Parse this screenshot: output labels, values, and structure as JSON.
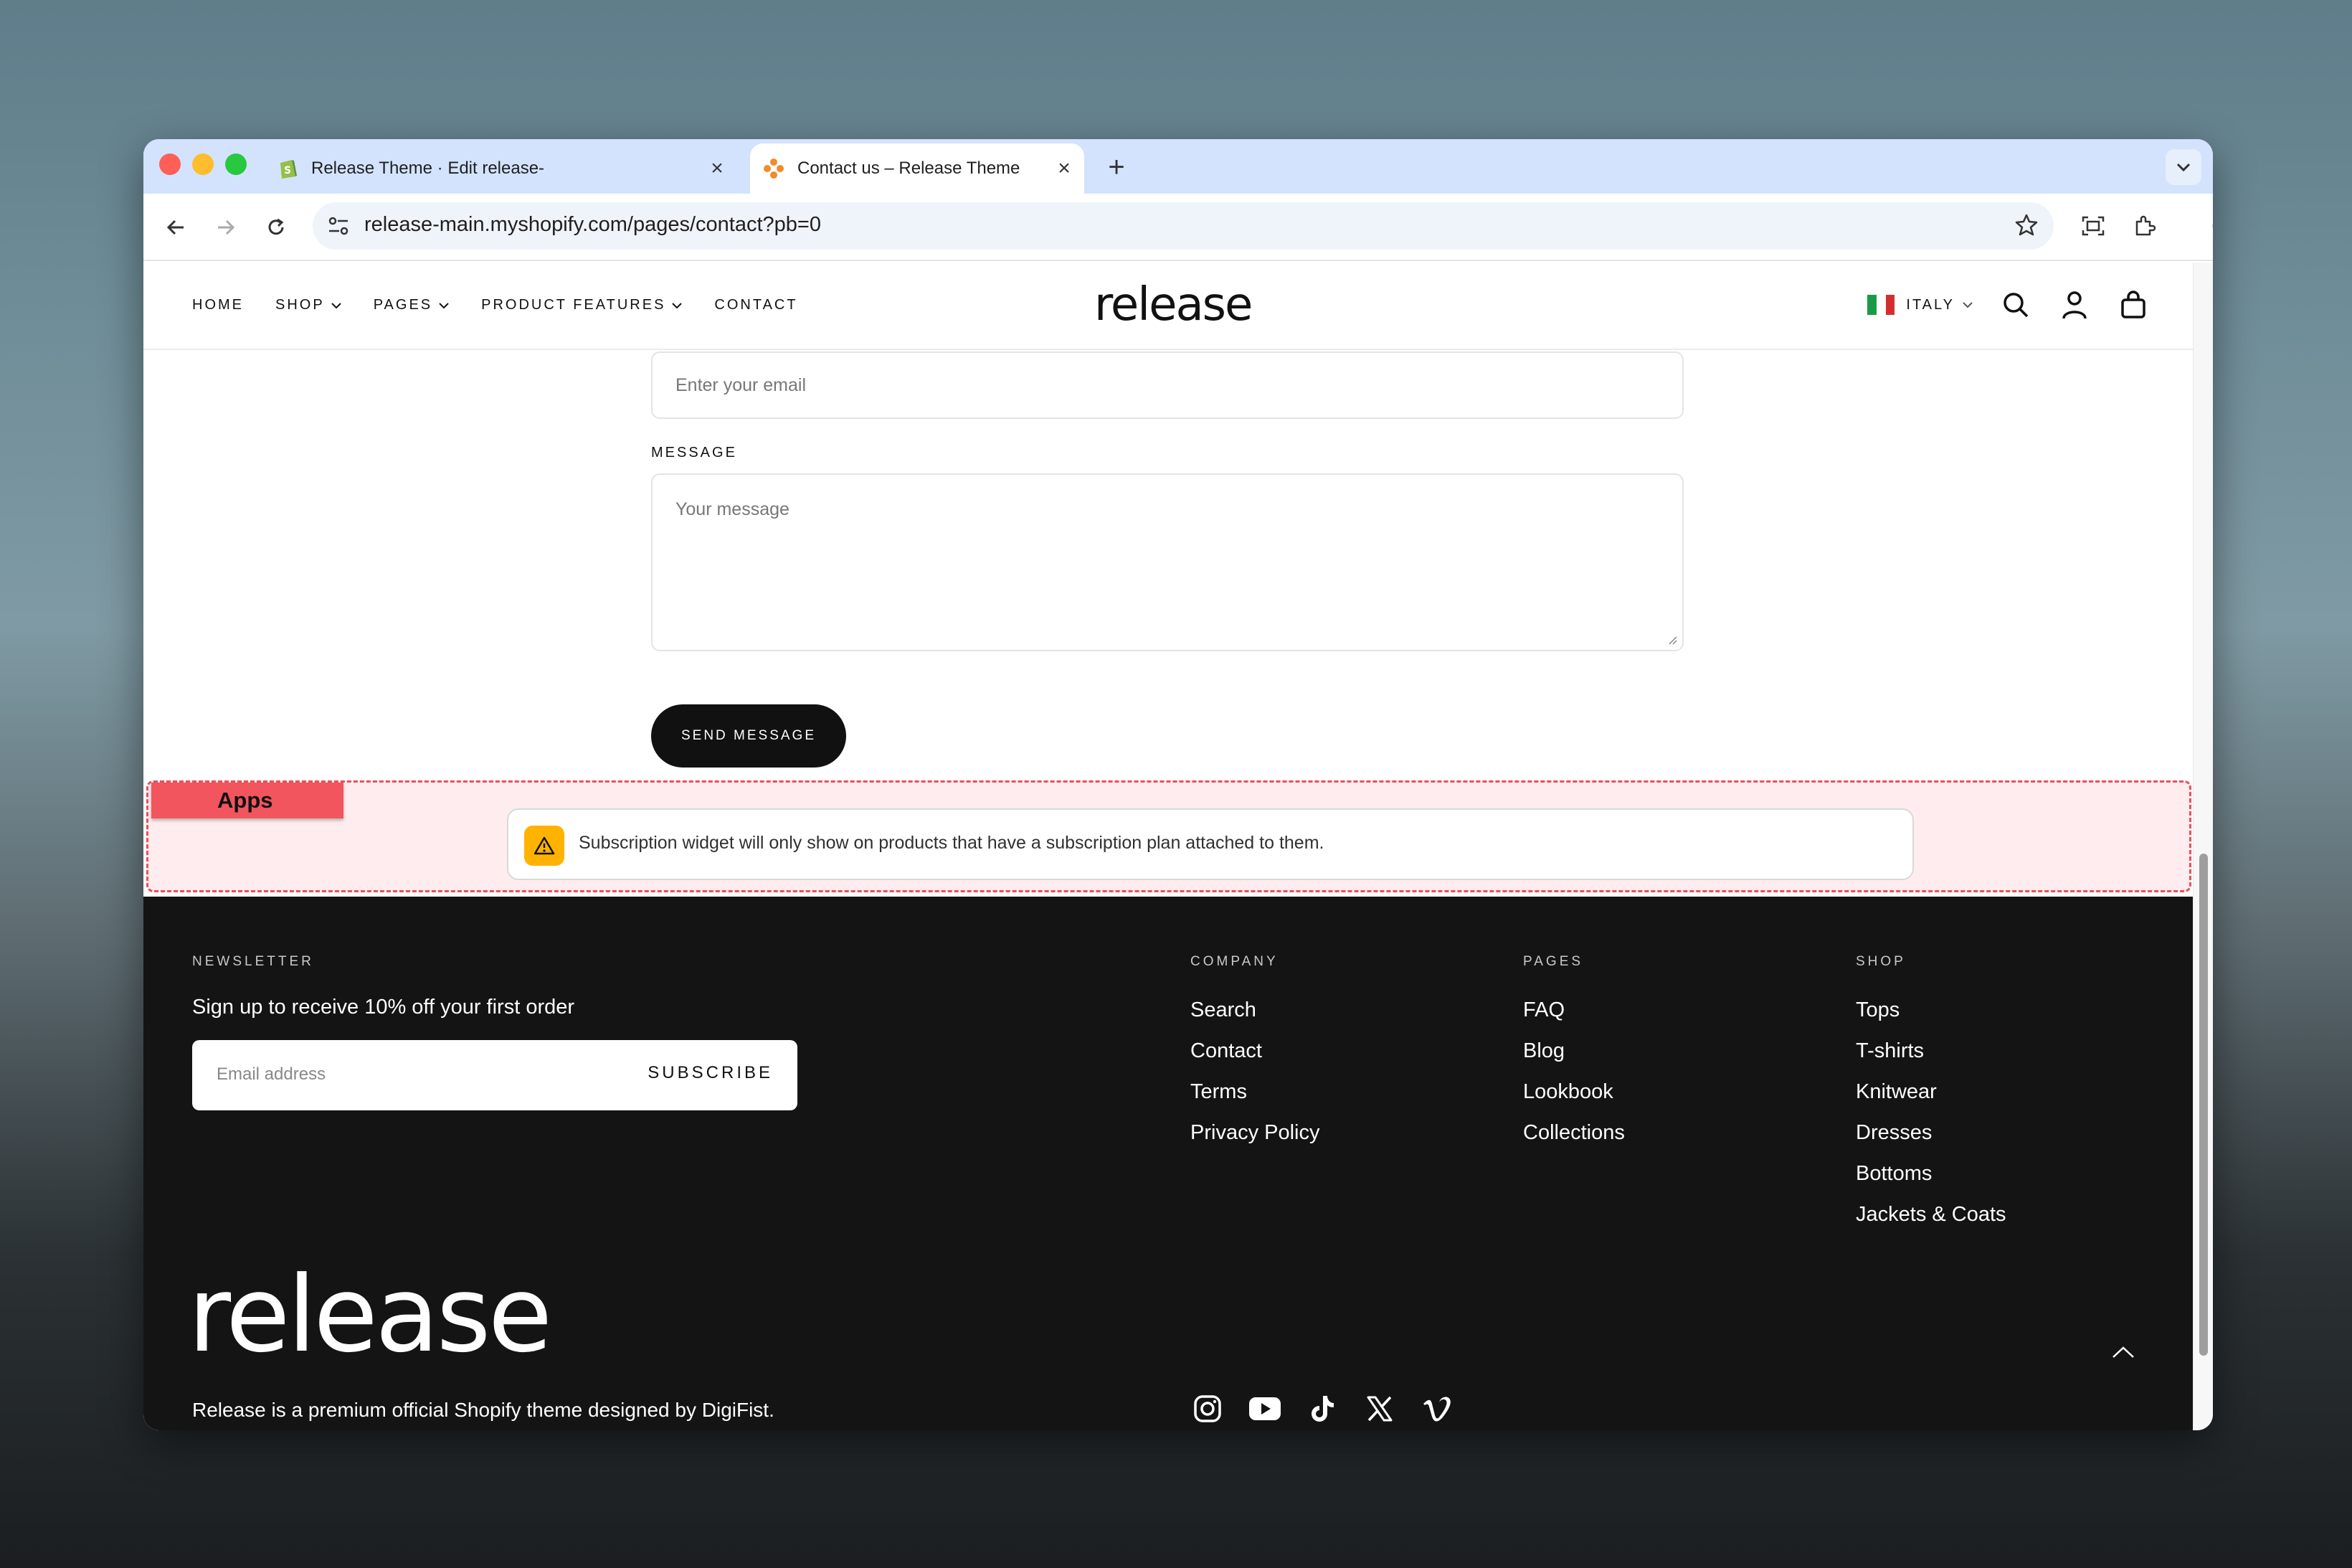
{
  "browser": {
    "tabs": [
      {
        "title": "Release Theme · Edit release-",
        "active": false
      },
      {
        "title": "Contact us – Release Theme",
        "active": true
      }
    ],
    "url": "release-main.myshopify.com/pages/contact?pb=0"
  },
  "header": {
    "nav": [
      {
        "label": "HOME",
        "has_dropdown": false
      },
      {
        "label": "SHOP",
        "has_dropdown": true
      },
      {
        "label": "PAGES",
        "has_dropdown": true
      },
      {
        "label": "PRODUCT FEATURES",
        "has_dropdown": true
      },
      {
        "label": "CONTACT",
        "has_dropdown": false
      }
    ],
    "logo": "release",
    "country": "ITALY"
  },
  "form": {
    "email_placeholder": "Enter your email",
    "message_label": "MESSAGE",
    "message_placeholder": "Your message",
    "send_label": "SEND MESSAGE"
  },
  "apps": {
    "tag": "Apps",
    "notice": "Subscription widget will only show on products that have a subscription plan attached to them."
  },
  "footer": {
    "newsletter": {
      "heading": "NEWSLETTER",
      "text": "Sign up to receive 10% off your first order",
      "email_placeholder": "Email address",
      "subscribe_label": "SUBSCRIBE"
    },
    "columns": [
      {
        "heading": "COMPANY",
        "links": [
          "Search",
          "Contact",
          "Terms",
          "Privacy Policy"
        ]
      },
      {
        "heading": "PAGES",
        "links": [
          "FAQ",
          "Blog",
          "Lookbook",
          "Collections"
        ]
      },
      {
        "heading": "SHOP",
        "links": [
          "Tops",
          "T-shirts",
          "Knitwear",
          "Dresses",
          "Bottoms",
          "Jackets & Coats"
        ]
      }
    ],
    "logo": "release",
    "tagline": "Release is a premium official Shopify theme designed by DigiFist.",
    "social": [
      "instagram-icon",
      "youtube-icon",
      "tiktok-icon",
      "x-icon",
      "vimeo-icon"
    ]
  },
  "colors": {
    "tabstrip": "#d3e3fd",
    "footer_bg": "#141414",
    "apps_bg": "#ffecee",
    "apps_border": "#e8505b",
    "warning": "#ffb300"
  }
}
